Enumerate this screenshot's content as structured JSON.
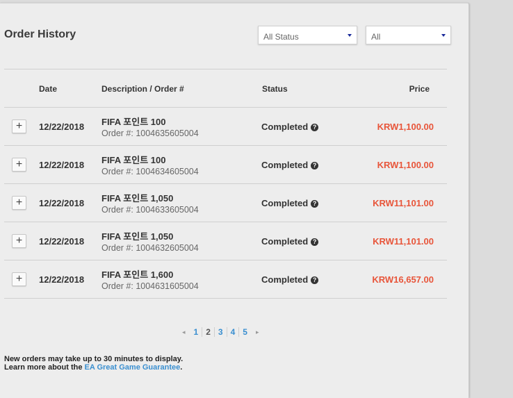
{
  "header": {
    "title": "Order History"
  },
  "filters": {
    "status": "All Status",
    "period": "All"
  },
  "table": {
    "columns": {
      "date": "Date",
      "description": "Description / Order #",
      "status": "Status",
      "price": "Price"
    },
    "rows": [
      {
        "date": "12/22/2018",
        "description": "FIFA 포인트 100",
        "order": "Order #: 1004635605004",
        "status": "Completed",
        "price": "KRW1,100.00"
      },
      {
        "date": "12/22/2018",
        "description": "FIFA 포인트 100",
        "order": "Order #: 1004634605004",
        "status": "Completed",
        "price": "KRW1,100.00"
      },
      {
        "date": "12/22/2018",
        "description": "FIFA 포인트 1,050",
        "order": "Order #: 1004633605004",
        "status": "Completed",
        "price": "KRW11,101.00"
      },
      {
        "date": "12/22/2018",
        "description": "FIFA 포인트 1,050",
        "order": "Order #: 1004632605004",
        "status": "Completed",
        "price": "KRW11,101.00"
      },
      {
        "date": "12/22/2018",
        "description": "FIFA 포인트 1,600",
        "order": "Order #: 1004631605004",
        "status": "Completed",
        "price": "KRW16,657.00"
      }
    ],
    "expand_symbol": "+",
    "help_symbol": "?"
  },
  "pagination": {
    "prev": "◂",
    "next": "▸",
    "pages": [
      "1",
      "2",
      "3",
      "4",
      "5"
    ],
    "current": "2"
  },
  "footer": {
    "line1": "New orders may take up to 30 minutes to display.",
    "line2_prefix": "Learn more about the ",
    "link": "EA Great Game Guarantee",
    "line2_suffix": "."
  },
  "colors": {
    "price": "#e8553a",
    "link": "#3a8fd0",
    "background": "#ededed"
  }
}
